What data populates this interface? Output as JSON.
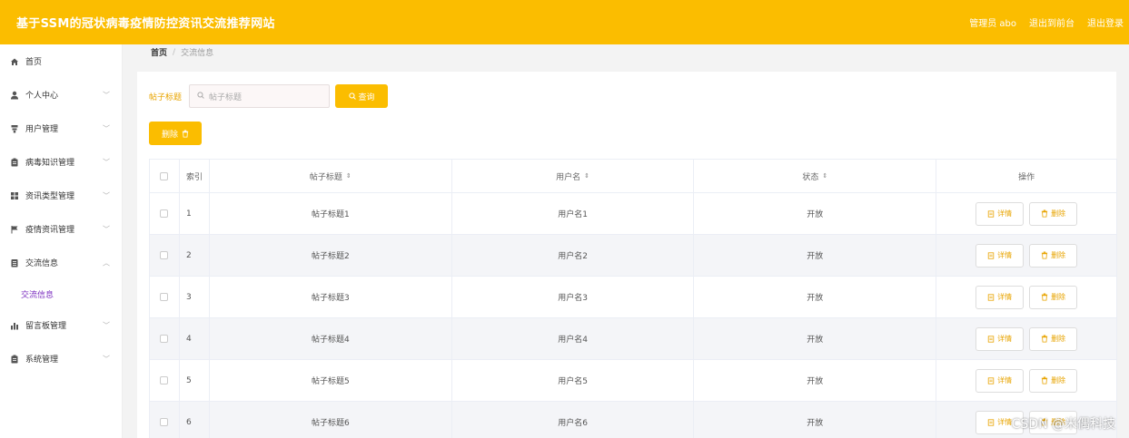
{
  "header": {
    "title": "基于SSM的冠状病毒疫情防控资讯交流推荐网站",
    "admin": "管理员 abo",
    "to_front": "退出到前台",
    "logout": "退出登录"
  },
  "sidebar": {
    "items": [
      {
        "label": "首页",
        "icon": "home-icon"
      },
      {
        "label": "个人中心",
        "icon": "user-icon"
      },
      {
        "label": "用户管理",
        "icon": "user-manage-icon"
      },
      {
        "label": "病毒知识管理",
        "icon": "clipboard-icon"
      },
      {
        "label": "资讯类型管理",
        "icon": "grid-icon"
      },
      {
        "label": "疫情资讯管理",
        "icon": "flag-icon"
      },
      {
        "label": "交流信息",
        "icon": "document-icon"
      },
      {
        "label": "留言板管理",
        "icon": "chart-icon"
      },
      {
        "label": "系统管理",
        "icon": "clipboard-icon"
      }
    ],
    "sub_item": "交流信息"
  },
  "breadcrumb": {
    "home": "首页",
    "sep": "/",
    "current": "交流信息"
  },
  "search": {
    "label": "帖子标题",
    "placeholder": "帖子标题",
    "button": "查询"
  },
  "delete_button": "删除",
  "table": {
    "headers": {
      "index": "索引",
      "title": "帖子标题",
      "user": "用户名",
      "state": "状态",
      "ops": "操作"
    },
    "detail_label": "详情",
    "delete_label": "删除",
    "rows": [
      {
        "index": "1",
        "title": "帖子标题1",
        "user": "用户名1",
        "state": "开放"
      },
      {
        "index": "2",
        "title": "帖子标题2",
        "user": "用户名2",
        "state": "开放"
      },
      {
        "index": "3",
        "title": "帖子标题3",
        "user": "用户名3",
        "state": "开放"
      },
      {
        "index": "4",
        "title": "帖子标题4",
        "user": "用户名4",
        "state": "开放"
      },
      {
        "index": "5",
        "title": "帖子标题5",
        "user": "用户名5",
        "state": "开放"
      },
      {
        "index": "6",
        "title": "帖子标题6",
        "user": "用户名6",
        "state": "开放"
      }
    ]
  },
  "watermark": "CSDN @米偶科技",
  "colors": {
    "accent": "#fbbd00",
    "submenu_active": "#7b2dbf"
  }
}
